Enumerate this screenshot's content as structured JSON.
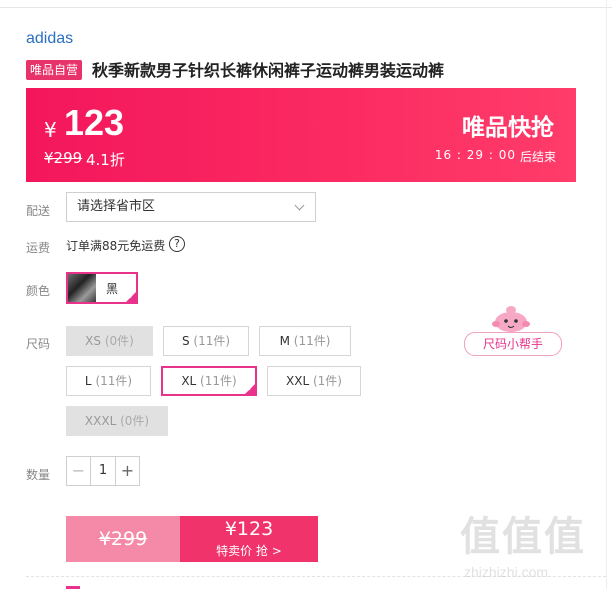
{
  "product": {
    "brand": "adidas",
    "badge": "唯品自营",
    "title": "秋季新款男子针织长裤休闲裤子运动裤男装运动裤"
  },
  "promo": {
    "currency": "¥",
    "price": "123",
    "original_price": "¥299",
    "discount": "4.1折",
    "flash_title": "唯品快抢",
    "countdown": "16 : 29 : 00",
    "countdown_suffix": "后结束"
  },
  "delivery": {
    "label": "配送",
    "select_value": "请选择省市区"
  },
  "shipping": {
    "label": "运费",
    "text": "订单满88元免运费",
    "help_icon": "question-circle-icon"
  },
  "color": {
    "label": "颜色",
    "options": [
      {
        "name": "黑",
        "selected": true
      }
    ]
  },
  "size": {
    "label": "尺码",
    "options": [
      {
        "name": "XS",
        "count": "(0件)",
        "state": "disabled"
      },
      {
        "name": "S",
        "count": "(11件)",
        "state": "available"
      },
      {
        "name": "M",
        "count": "(11件)",
        "state": "available"
      },
      {
        "name": "L",
        "count": "(11件)",
        "state": "available"
      },
      {
        "name": "XL",
        "count": "(11件)",
        "state": "selected"
      },
      {
        "name": "XXL",
        "count": "(1件)",
        "state": "available"
      },
      {
        "name": "XXXL",
        "count": "(0件)",
        "state": "disabled"
      }
    ],
    "helper_label": "尺码小帮手"
  },
  "quantity": {
    "label": "数量",
    "value": "1",
    "minus": "−",
    "plus": "+"
  },
  "buy": {
    "original_price": "¥299",
    "price": "¥123",
    "cta": "特卖价 抢 >"
  },
  "watermark": {
    "glyphs": "值值值",
    "url": "zhizhizhi.com"
  },
  "colors": {
    "accent": "#e8328c",
    "banner": "#f3165c",
    "brand_link": "#2b6fbf"
  }
}
